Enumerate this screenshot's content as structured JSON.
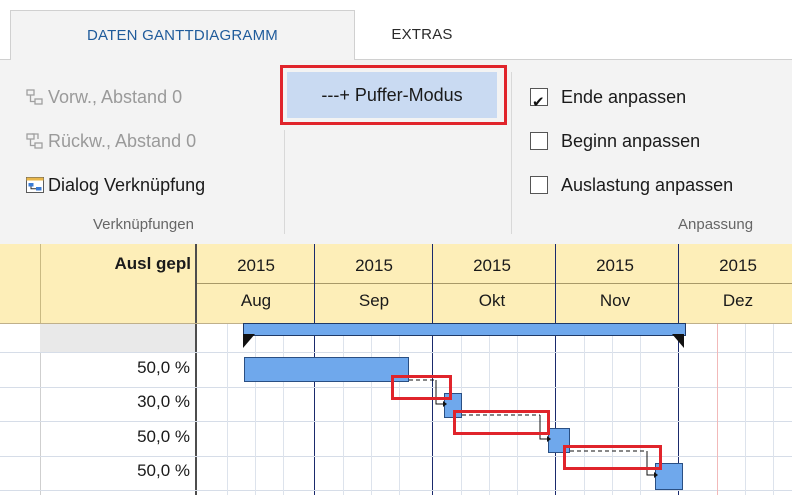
{
  "tabs": {
    "daten": "DATEN GANTTDIAGRAMM",
    "extras": "EXTRAS"
  },
  "verknuepfungen": {
    "vorw": "Vorw., Abstand 0",
    "rueckw": "Rückw., Abstand 0",
    "dialog": "Dialog Verknüpfung",
    "group_label": "Verknüpfungen"
  },
  "puffer": {
    "label": "---+ Puffer-Modus"
  },
  "anpassung": {
    "ende": {
      "label": "Ende anpassen",
      "checked": true
    },
    "beginn": {
      "label": "Beginn anpassen",
      "checked": false
    },
    "auslastung": {
      "label": "Auslastung anpassen",
      "checked": false
    },
    "group_label": "Anpassung"
  },
  "timeline": {
    "column_title": "Ausl gepl",
    "periods": [
      {
        "year": "2015",
        "month": "Aug"
      },
      {
        "year": "2015",
        "month": "Sep"
      },
      {
        "year": "2015",
        "month": "Okt"
      },
      {
        "year": "2015",
        "month": "Nov"
      },
      {
        "year": "2015",
        "month": "Dez"
      }
    ]
  },
  "rows": [
    {
      "label": ""
    },
    {
      "label": "50,0 %"
    },
    {
      "label": "30,0 %"
    },
    {
      "label": "50,0 %"
    },
    {
      "label": "50,0 %"
    }
  ],
  "colors": {
    "bar_fill": "#6fa8ec",
    "highlight": "#e0242b",
    "header_bg": "#fdeeb8",
    "month_line": "#1a2a6c"
  }
}
